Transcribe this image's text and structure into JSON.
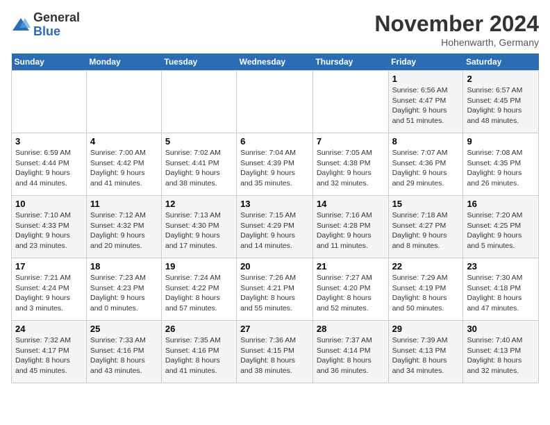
{
  "logo": {
    "general": "General",
    "blue": "Blue"
  },
  "title": "November 2024",
  "location": "Hohenwarth, Germany",
  "days_of_week": [
    "Sunday",
    "Monday",
    "Tuesday",
    "Wednesday",
    "Thursday",
    "Friday",
    "Saturday"
  ],
  "weeks": [
    [
      {
        "day": "",
        "info": ""
      },
      {
        "day": "",
        "info": ""
      },
      {
        "day": "",
        "info": ""
      },
      {
        "day": "",
        "info": ""
      },
      {
        "day": "",
        "info": ""
      },
      {
        "day": "1",
        "info": "Sunrise: 6:56 AM\nSunset: 4:47 PM\nDaylight: 9 hours and 51 minutes."
      },
      {
        "day": "2",
        "info": "Sunrise: 6:57 AM\nSunset: 4:45 PM\nDaylight: 9 hours and 48 minutes."
      }
    ],
    [
      {
        "day": "3",
        "info": "Sunrise: 6:59 AM\nSunset: 4:44 PM\nDaylight: 9 hours and 44 minutes."
      },
      {
        "day": "4",
        "info": "Sunrise: 7:00 AM\nSunset: 4:42 PM\nDaylight: 9 hours and 41 minutes."
      },
      {
        "day": "5",
        "info": "Sunrise: 7:02 AM\nSunset: 4:41 PM\nDaylight: 9 hours and 38 minutes."
      },
      {
        "day": "6",
        "info": "Sunrise: 7:04 AM\nSunset: 4:39 PM\nDaylight: 9 hours and 35 minutes."
      },
      {
        "day": "7",
        "info": "Sunrise: 7:05 AM\nSunset: 4:38 PM\nDaylight: 9 hours and 32 minutes."
      },
      {
        "day": "8",
        "info": "Sunrise: 7:07 AM\nSunset: 4:36 PM\nDaylight: 9 hours and 29 minutes."
      },
      {
        "day": "9",
        "info": "Sunrise: 7:08 AM\nSunset: 4:35 PM\nDaylight: 9 hours and 26 minutes."
      }
    ],
    [
      {
        "day": "10",
        "info": "Sunrise: 7:10 AM\nSunset: 4:33 PM\nDaylight: 9 hours and 23 minutes."
      },
      {
        "day": "11",
        "info": "Sunrise: 7:12 AM\nSunset: 4:32 PM\nDaylight: 9 hours and 20 minutes."
      },
      {
        "day": "12",
        "info": "Sunrise: 7:13 AM\nSunset: 4:30 PM\nDaylight: 9 hours and 17 minutes."
      },
      {
        "day": "13",
        "info": "Sunrise: 7:15 AM\nSunset: 4:29 PM\nDaylight: 9 hours and 14 minutes."
      },
      {
        "day": "14",
        "info": "Sunrise: 7:16 AM\nSunset: 4:28 PM\nDaylight: 9 hours and 11 minutes."
      },
      {
        "day": "15",
        "info": "Sunrise: 7:18 AM\nSunset: 4:27 PM\nDaylight: 9 hours and 8 minutes."
      },
      {
        "day": "16",
        "info": "Sunrise: 7:20 AM\nSunset: 4:25 PM\nDaylight: 9 hours and 5 minutes."
      }
    ],
    [
      {
        "day": "17",
        "info": "Sunrise: 7:21 AM\nSunset: 4:24 PM\nDaylight: 9 hours and 3 minutes."
      },
      {
        "day": "18",
        "info": "Sunrise: 7:23 AM\nSunset: 4:23 PM\nDaylight: 9 hours and 0 minutes."
      },
      {
        "day": "19",
        "info": "Sunrise: 7:24 AM\nSunset: 4:22 PM\nDaylight: 8 hours and 57 minutes."
      },
      {
        "day": "20",
        "info": "Sunrise: 7:26 AM\nSunset: 4:21 PM\nDaylight: 8 hours and 55 minutes."
      },
      {
        "day": "21",
        "info": "Sunrise: 7:27 AM\nSunset: 4:20 PM\nDaylight: 8 hours and 52 minutes."
      },
      {
        "day": "22",
        "info": "Sunrise: 7:29 AM\nSunset: 4:19 PM\nDaylight: 8 hours and 50 minutes."
      },
      {
        "day": "23",
        "info": "Sunrise: 7:30 AM\nSunset: 4:18 PM\nDaylight: 8 hours and 47 minutes."
      }
    ],
    [
      {
        "day": "24",
        "info": "Sunrise: 7:32 AM\nSunset: 4:17 PM\nDaylight: 8 hours and 45 minutes."
      },
      {
        "day": "25",
        "info": "Sunrise: 7:33 AM\nSunset: 4:16 PM\nDaylight: 8 hours and 43 minutes."
      },
      {
        "day": "26",
        "info": "Sunrise: 7:35 AM\nSunset: 4:16 PM\nDaylight: 8 hours and 41 minutes."
      },
      {
        "day": "27",
        "info": "Sunrise: 7:36 AM\nSunset: 4:15 PM\nDaylight: 8 hours and 38 minutes."
      },
      {
        "day": "28",
        "info": "Sunrise: 7:37 AM\nSunset: 4:14 PM\nDaylight: 8 hours and 36 minutes."
      },
      {
        "day": "29",
        "info": "Sunrise: 7:39 AM\nSunset: 4:13 PM\nDaylight: 8 hours and 34 minutes."
      },
      {
        "day": "30",
        "info": "Sunrise: 7:40 AM\nSunset: 4:13 PM\nDaylight: 8 hours and 32 minutes."
      }
    ]
  ]
}
